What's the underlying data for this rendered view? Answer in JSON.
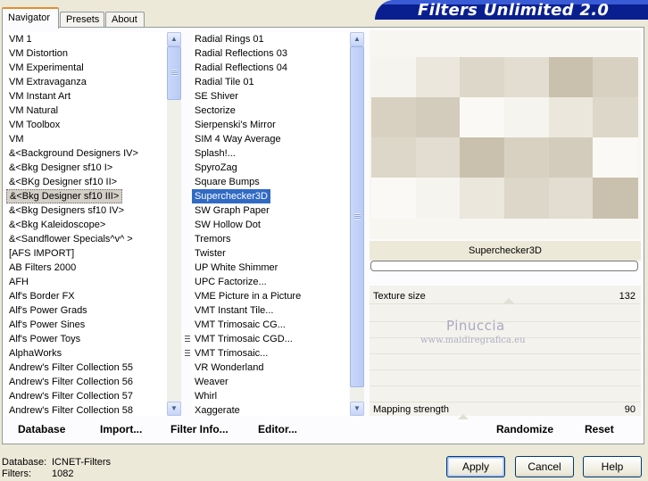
{
  "tabs": [
    {
      "label": "Navigator",
      "active": true
    },
    {
      "label": "Presets",
      "active": false
    },
    {
      "label": "About",
      "active": false
    }
  ],
  "app_title": "Filters Unlimited 2.0",
  "categories": [
    "VM 1",
    "VM Distortion",
    "VM Experimental",
    "VM Extravaganza",
    "VM Instant Art",
    "VM Natural",
    "VM Toolbox",
    "VM",
    "&<Background Designers IV>",
    "&<Bkg Designer sf10 I>",
    "&<BKg Designer sf10 II>",
    "&<Bkg Designer sf10 III>",
    "&<Bkg Designers sf10 IV>",
    "&<Bkg Kaleidoscope>",
    "&<Sandflower Specials^v^ >",
    "[AFS IMPORT]",
    "AB Filters 2000",
    "AFH",
    "Alf's Border FX",
    "Alf's Power Grads",
    "Alf's Power Sines",
    "Alf's Power Toys",
    "AlphaWorks",
    "Andrew's Filter Collection 55",
    "Andrew's Filter Collection 56",
    "Andrew's Filter Collection 57",
    "Andrew's Filter Collection 58"
  ],
  "selected_category": "&<Bkg Designer sf10 III>",
  "filters": [
    "Radial  Rings 01",
    "Radial Reflections 03",
    "Radial Reflections 04",
    "Radial Tile 01",
    "SE Shiver",
    "Sectorize",
    "Sierpenski's Mirror",
    "SIM 4 Way Average",
    "Splash!...",
    "SpyroZag",
    "Square Bumps",
    "Superchecker3D",
    "SW Graph Paper",
    "SW Hollow Dot",
    "Tremors",
    "Twister",
    "UP White Shimmer",
    "UPC Factorize...",
    "VME Picture in a Picture",
    "VMT Instant Tile...",
    "VMT Trimosaic CG...",
    "VMT Trimosaic CGD...",
    "VMT Trimosaic...",
    "VR Wonderland",
    "Weaver",
    "Whirl",
    "Xaggerate"
  ],
  "selected_filter": "Superchecker3D",
  "list_buttons": {
    "database": "Database",
    "import": "Import...",
    "filter_info": "Filter Info...",
    "editor": "Editor..."
  },
  "preview": {
    "filter_name": "Superchecker3D",
    "progress": 0
  },
  "sliders": [
    {
      "label": "Texture size",
      "value": "132",
      "fraction": 0.52
    },
    {
      "label": "Mapping strength",
      "value": "90",
      "fraction": 0.35
    }
  ],
  "watermark": {
    "name": "Pinuccia",
    "site": "www.maidiregrafica.eu"
  },
  "actions": {
    "randomize": "Randomize",
    "reset": "Reset"
  },
  "status": {
    "database_label": "Database:",
    "database_value": "ICNET-Filters",
    "filters_label": "Filters:",
    "filters_value": "1082"
  },
  "dialog_buttons": {
    "apply": "Apply",
    "cancel": "Cancel",
    "help": "Help"
  },
  "icons": {
    "scroll_up": "scroll-up-arrow-icon",
    "scroll_down": "scroll-down-arrow-icon",
    "grip": "drag-grip-icon"
  },
  "colors": {
    "brand_blue": "#0a1f8f",
    "selection_blue": "#316ac5",
    "selection_gray": "#d4d0c8",
    "tab_accent": "#e68b2c"
  }
}
